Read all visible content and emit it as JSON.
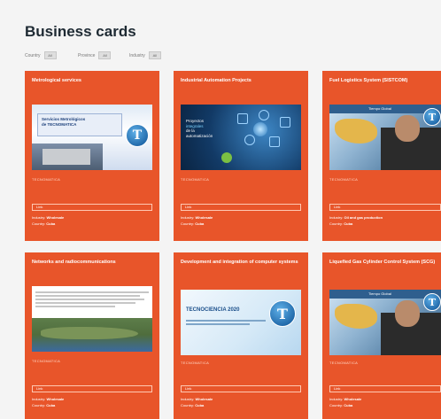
{
  "page": {
    "title": "Business cards"
  },
  "filters": [
    {
      "label": "Country",
      "value": "All"
    },
    {
      "label": "Province",
      "value": "All"
    },
    {
      "label": "Industry",
      "value": "All"
    }
  ],
  "cards": [
    {
      "title": "Metrological services",
      "thumb_text": [
        "Servicios Metrológicos",
        "de TECNOMATICA"
      ],
      "company": "TECNOMATICA",
      "tag": "Link",
      "industry_label": "Industry:",
      "industry_value": "Wholesale",
      "country_label": "Country:",
      "country_value": "Cuba"
    },
    {
      "title": "Industrial Automation Projects",
      "thumb_text": [
        "Proyectos",
        "integrales",
        "de la",
        "automatización"
      ],
      "company": "TECNOMATICA",
      "tag": "Link",
      "industry_label": "Industry:",
      "industry_value": "Wholesale",
      "country_label": "Country:",
      "country_value": "Cuba"
    },
    {
      "title": "Fuel Logistics System (SISTCOM)",
      "thumb_text": [
        "Tiempo Global"
      ],
      "company": "TECNOMATICA",
      "tag": "Link",
      "industry_label": "Industry:",
      "industry_value": "Oil and gas production",
      "country_label": "Country:",
      "country_value": "Cuba"
    },
    {
      "title": "Networks and radiocommunications",
      "thumb_text": [],
      "company": "TECNOMATICA",
      "tag": "Link",
      "industry_label": "Industry:",
      "industry_value": "Wholesale",
      "country_label": "Country:",
      "country_value": "Cuba"
    },
    {
      "title": "Development and integration of computer systems",
      "thumb_text": [
        "TECNOCIENCIA 2020"
      ],
      "company": "TECNOMATICA",
      "tag": "Link",
      "industry_label": "Industry:",
      "industry_value": "Wholesale",
      "country_label": "Country:",
      "country_value": "Cuba"
    },
    {
      "title": "Liquefied Gas Cylinder Control System (SCG)",
      "thumb_text": [
        "Tiempo Global"
      ],
      "company": "TECNOMATICA",
      "tag": "Link",
      "industry_label": "Industry:",
      "industry_value": "Wholesale",
      "country_label": "Country:",
      "country_value": "Cuba"
    }
  ],
  "colors": {
    "card": "#e8552a",
    "background": "#f4f4f4"
  }
}
